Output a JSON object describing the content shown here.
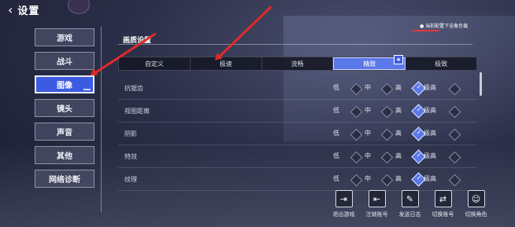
{
  "header": {
    "back_icon": "back-arrow-icon",
    "title": "设置"
  },
  "recommend_note": "● 当前配置下设备负载",
  "sidebar": {
    "items": [
      {
        "label": "游戏",
        "active": false
      },
      {
        "label": "战斗",
        "active": false
      },
      {
        "label": "图像",
        "active": true
      },
      {
        "label": "镜头",
        "active": false
      },
      {
        "label": "声音",
        "active": false
      },
      {
        "label": "其他",
        "active": false
      },
      {
        "label": "网络诊断",
        "active": false
      }
    ]
  },
  "section": {
    "title": "画质设置"
  },
  "quality_tabs": [
    {
      "label": "自定义",
      "active": false
    },
    {
      "label": "极速",
      "active": false
    },
    {
      "label": "流畅",
      "active": false
    },
    {
      "label": "精致",
      "active": true,
      "recommended": true
    },
    {
      "label": "极致",
      "active": false
    }
  ],
  "options": {
    "low": "低",
    "mid": "中",
    "high": "高",
    "ultra": "极高"
  },
  "settings": [
    {
      "label": "抗锯齿",
      "selected": "高"
    },
    {
      "label": "视图距离",
      "selected": "高"
    },
    {
      "label": "阴影",
      "selected": "高"
    },
    {
      "label": "特效",
      "selected": "高"
    },
    {
      "label": "纹理",
      "selected": "高"
    }
  ],
  "actions": [
    {
      "label": "退出游戏",
      "icon": "exit-game-icon"
    },
    {
      "label": "注销账号",
      "icon": "logout-account-icon"
    },
    {
      "label": "发送日志",
      "icon": "send-log-icon"
    },
    {
      "label": "切换账号",
      "icon": "switch-account-icon"
    },
    {
      "label": "切换角色",
      "icon": "switch-character-icon"
    }
  ],
  "colors": {
    "accent": "#3c5be0",
    "arrow": "#e02a2a"
  }
}
